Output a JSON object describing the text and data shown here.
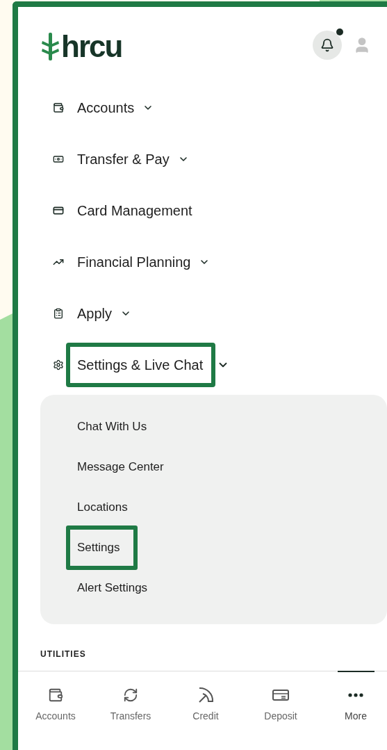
{
  "header": {
    "logo_text": "hrcu",
    "has_notification": true
  },
  "menu": [
    {
      "label": "Accounts",
      "expanded": false,
      "highlighted": false
    },
    {
      "label": "Transfer & Pay",
      "expanded": false,
      "highlighted": false
    },
    {
      "label": "Card Management",
      "highlighted": false
    },
    {
      "label": "Financial Planning",
      "expanded": false,
      "highlighted": false
    },
    {
      "label": "Apply",
      "expanded": false,
      "highlighted": false
    },
    {
      "label": "Settings & Live Chat",
      "expanded": true,
      "highlighted": true,
      "children": [
        {
          "label": "Chat With Us",
          "highlighted": false
        },
        {
          "label": "Message Center",
          "highlighted": false
        },
        {
          "label": "Locations",
          "highlighted": false
        },
        {
          "label": "Settings",
          "highlighted": true
        },
        {
          "label": "Alert Settings",
          "highlighted": false
        }
      ]
    }
  ],
  "section_heading": "UTILITIES",
  "bottom_nav": [
    {
      "label": "Accounts",
      "selected": false
    },
    {
      "label": "Transfers",
      "selected": false
    },
    {
      "label": "Credit",
      "selected": false
    },
    {
      "label": "Deposit",
      "selected": false
    },
    {
      "label": "More",
      "selected": true
    }
  ]
}
